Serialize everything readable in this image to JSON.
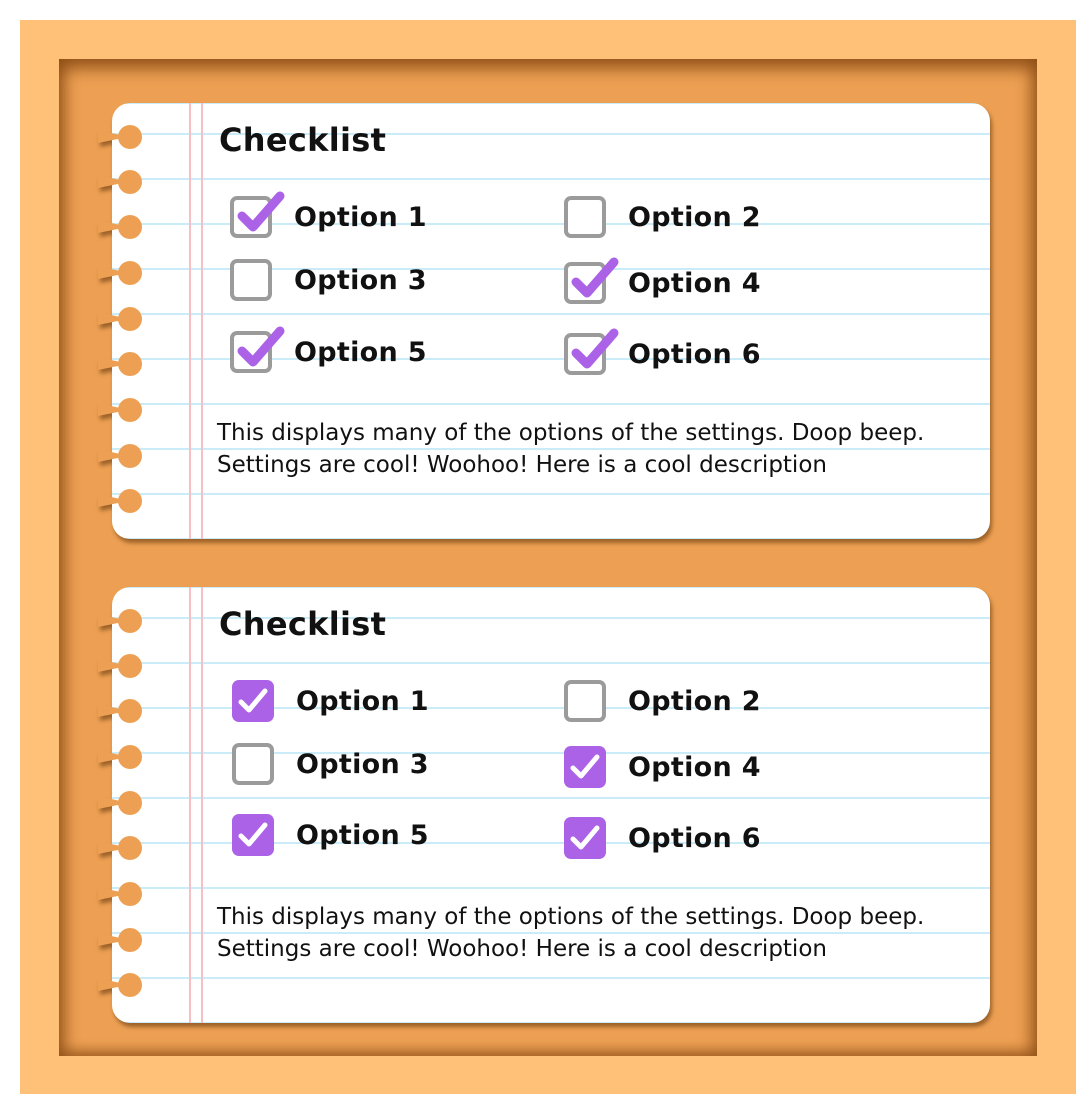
{
  "colors": {
    "outer_frame": "#fec177",
    "board": "#eda053",
    "paper": "#ffffff",
    "ruled_line": "#c9ecf8",
    "margin_line": "#f6bfc6",
    "check_purple": "#ab62e6",
    "box_border": "#9b9b9b"
  },
  "cards": [
    {
      "title": "Checklist",
      "style": "outline",
      "options": [
        {
          "label": "Option 1",
          "checked": true
        },
        {
          "label": "Option 2",
          "checked": false
        },
        {
          "label": "Option 3",
          "checked": false
        },
        {
          "label": "Option 4",
          "checked": true
        },
        {
          "label": "Option 5",
          "checked": true
        },
        {
          "label": "Option 6",
          "checked": true
        }
      ],
      "description": "This displays many of the options of the settings. Doop beep. Settings are cool! Woohoo! Here is a cool description"
    },
    {
      "title": "Checklist",
      "style": "filled",
      "options": [
        {
          "label": "Option 1",
          "checked": true
        },
        {
          "label": "Option 2",
          "checked": false
        },
        {
          "label": "Option 3",
          "checked": false
        },
        {
          "label": "Option 4",
          "checked": true
        },
        {
          "label": "Option 5",
          "checked": true
        },
        {
          "label": "Option 6",
          "checked": true
        }
      ],
      "description": "This displays many of the options of the settings. Doop beep. Settings are cool! Woohoo! Here is a cool description"
    }
  ]
}
